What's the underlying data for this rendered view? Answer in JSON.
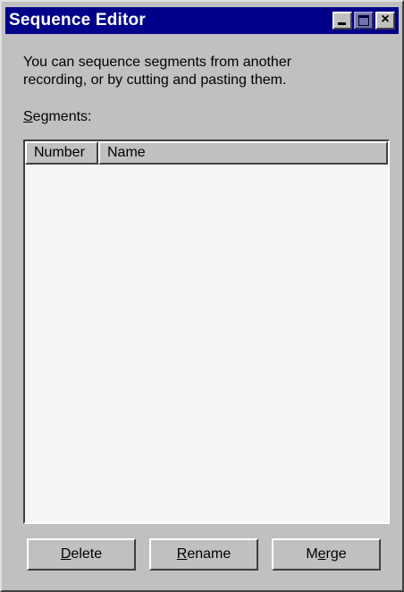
{
  "window": {
    "title": "Sequence Editor",
    "buttons": {
      "minimize": "minimize",
      "maximize": "maximize",
      "close": "×"
    }
  },
  "description": {
    "line1": "You can sequence segments from another",
    "line2": "recording, or by cutting and pasting them."
  },
  "segments": {
    "label_mnemonic": "S",
    "label_rest": "egments:",
    "columns": [
      "Number",
      "Name"
    ],
    "rows": []
  },
  "buttons": {
    "delete": {
      "mnemonic": "D",
      "rest": "elete"
    },
    "rename": {
      "mnemonic": "R",
      "rest": "ename"
    },
    "merge": {
      "pre": "M",
      "mnemonic": "e",
      "rest": "rge"
    }
  },
  "colors": {
    "titlebar": "#00008a",
    "face": "#c0c0c0",
    "list_background": "#f5f5f5"
  }
}
